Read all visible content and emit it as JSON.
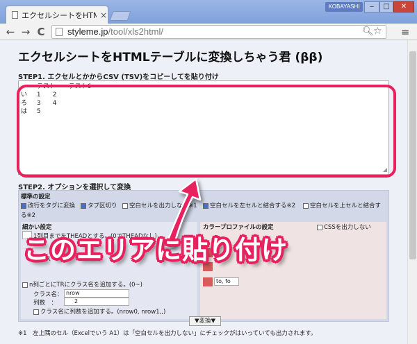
{
  "browser": {
    "tab_title": "エクセルシートをHTMLテ",
    "tab_close": "×",
    "profile": "KOBAYASHI",
    "win_min": "‒",
    "win_max": "□",
    "win_close": "✕",
    "nav_back": "←",
    "nav_forward": "→",
    "nav_reload": "C",
    "url_domain": "styleme.jp",
    "url_path": "/tool/xls2html/",
    "menu_icon": "≡"
  },
  "page": {
    "title": "エクセルシートをHTMLテーブルに変換しちゃう君 (ββ)",
    "step1_label": "STEP1. エクセルとかからCSV (TSV)をコピーしてを貼り付け",
    "textarea_lines": [
      "\tテスト\tテスト6",
      "い\t1\t2",
      "ろ\t3\t4",
      "は\t5"
    ],
    "step2_label": "STEP2. オプションを選択して変換",
    "standard_settings": "標準の設定",
    "options": [
      {
        "label": "改行をタグに変換",
        "checked": true
      },
      {
        "label": "タブ区切り",
        "checked": true
      },
      {
        "label": "空白セルを出力しない※1",
        "checked": false
      },
      {
        "label": "空白セルを左セルと結合する※2",
        "checked": true
      },
      {
        "label": "空白セルを上セルと結合す",
        "checked": false
      }
    ],
    "option_suffix": "る※2",
    "detail_settings": "細かい設定",
    "thead_option": "1列目までをTHEADとする。(0でTHEADなし)",
    "class_label_1": "クラス",
    "tr_class_option": "n列ごとにTRにクラス名を追加する。(0~)",
    "class_name_label": "クラス名：",
    "class_name_value": "nrow",
    "column_count_label": "列数　：",
    "column_count_value": "2",
    "class_num_option": "クラス名に列数を追加する。(nrow0, nrow1,,)",
    "color_profile": "カラープロファイルの設定",
    "css_option": "CSSを出力しない",
    "color_value": "to, fo",
    "convert_button": "▼変換▼",
    "note_1": "※1　左上隅のセル（Excelでいう A1）は「空白セルを出力しない」にチェックがはいっていても出力されます。"
  },
  "overlay": {
    "banner": "このエリアに貼り付け",
    "accent_color": "#e8215e"
  }
}
